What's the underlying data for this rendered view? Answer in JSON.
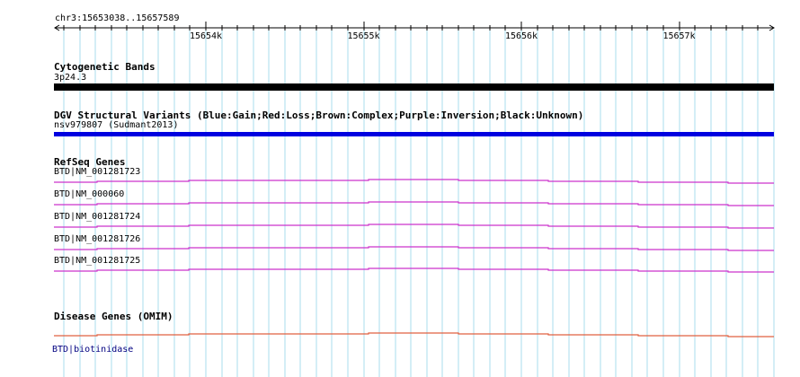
{
  "location": "chr3:15653038..15657589",
  "ruler": {
    "ticks": [
      {
        "label": "15654k",
        "pos": 15654000
      },
      {
        "label": "15655k",
        "pos": 15655000
      },
      {
        "label": "15656k",
        "pos": 15656000
      },
      {
        "label": "15657k",
        "pos": 15657000
      }
    ]
  },
  "tracks": {
    "cytoband": {
      "title": "Cytogenetic Bands",
      "label": "3p24.3",
      "color": "#000000"
    },
    "dgv": {
      "title": "DGV Structural Variants (Blue:Gain;Red:Loss;Brown:Complex;Purple:Inversion;Black:Unknown)",
      "label": "nsv979807 (Sudmant2013)",
      "color": "#0000e0"
    },
    "refseq": {
      "title": "RefSeq Genes",
      "color": "#cc33cc",
      "features": [
        {
          "label": "BTD|NM_001281723"
        },
        {
          "label": "BTD|NM_000060"
        },
        {
          "label": "BTD|NM_001281724"
        },
        {
          "label": "BTD|NM_001281726"
        },
        {
          "label": "BTD|NM_001281725"
        }
      ]
    },
    "omim": {
      "title": "Disease Genes (OMIM)",
      "label": "BTD|biotinidase",
      "color": "#e06040"
    }
  },
  "colors": {
    "grid": "#aaddee",
    "axis": "#000000",
    "label_blue": "#000080"
  }
}
